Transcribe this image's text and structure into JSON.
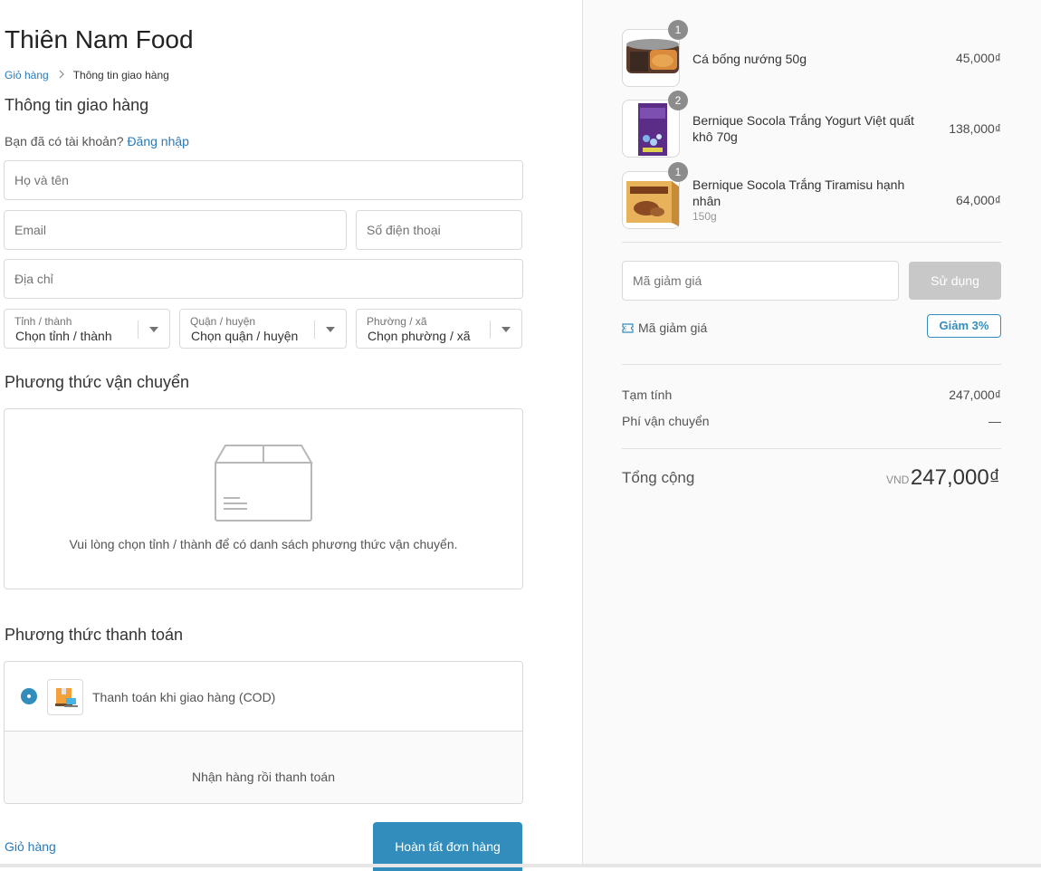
{
  "shop": {
    "title": "Thiên Nam Food"
  },
  "breadcrumb": {
    "cart": "Giỏ hàng",
    "current": "Thông tin giao hàng"
  },
  "info": {
    "title": "Thông tin giao hàng",
    "have_account": "Bạn đã có tài khoản?",
    "login": "Đăng nhập"
  },
  "fields": {
    "name_placeholder": "Họ và tên",
    "email_placeholder": "Email",
    "phone_placeholder": "Số điện thoại",
    "address_placeholder": "Địa chỉ"
  },
  "selects": {
    "province": {
      "label": "Tỉnh / thành",
      "value": "Chọn tỉnh / thành"
    },
    "district": {
      "label": "Quận / huyện",
      "value": "Chọn quận / huyện"
    },
    "ward": {
      "label": "Phường / xã",
      "value": "Chọn phường / xã"
    }
  },
  "shipping": {
    "title": "Phương thức vận chuyển",
    "empty": "Vui lòng chọn tỉnh / thành để có danh sách phương thức vận chuyển."
  },
  "payment": {
    "title": "Phương thức thanh toán",
    "method_label": "Thanh toán khi giao hàng (COD)",
    "method_detail": "Nhận hàng rồi thanh toán"
  },
  "footer": {
    "back": "Giỏ hàng",
    "complete": "Hoàn tất đơn hàng"
  },
  "cart": {
    "items": [
      {
        "name": "Cá bống nướng 50g",
        "variant": "",
        "qty": "1",
        "price": "45,000₫"
      },
      {
        "name": "Bernique Socola Trắng Yogurt Việt quất khô 70g",
        "variant": "",
        "qty": "2",
        "price": "138,000₫"
      },
      {
        "name": "Bernique Socola Trắng Tiramisu hạnh nhân",
        "variant": "150g",
        "qty": "1",
        "price": "64,000₫"
      }
    ]
  },
  "discount": {
    "placeholder": "Mã giảm giá",
    "apply": "Sử dụng",
    "coupon_label": "Mã giảm giá",
    "badge": "Giảm 3%"
  },
  "summary": {
    "subtotal_label": "Tạm tính",
    "subtotal": "247,000₫",
    "shipping_label": "Phí vận chuyển",
    "shipping": "—",
    "total_label": "Tổng cộng",
    "currency": "VND",
    "total": "247,000₫"
  },
  "colors": {
    "accent": "#338dbc",
    "link": "#2a7ab8"
  }
}
